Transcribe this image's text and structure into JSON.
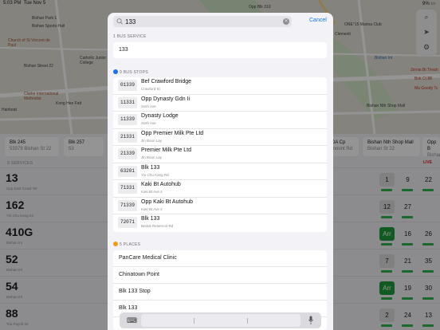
{
  "status_bar": {
    "time": "5:03 PM",
    "date": "Tue Nov 5",
    "right": "9% ▭"
  },
  "map": {
    "labels": [
      {
        "text": "Bishan Park 1",
        "tone": "normal"
      },
      {
        "text": "Bishan Sports Hall",
        "tone": "normal"
      },
      {
        "text": "ONE°15 Marina Club",
        "tone": "normal"
      },
      {
        "text": "Church of St Vincent de Paul",
        "tone": "brown"
      },
      {
        "text": "Bishan Street 22",
        "tone": "normal"
      },
      {
        "text": "Catholic Junior College",
        "tone": "normal"
      },
      {
        "text": "Clementi",
        "tone": "normal"
      },
      {
        "text": "Opp Blk 310",
        "tone": "normal"
      },
      {
        "text": "Clarke International Methodist",
        "tone": "brown"
      },
      {
        "text": "Kong Hee Fatt",
        "tone": "normal"
      },
      {
        "text": "Hairbeat",
        "tone": "normal"
      },
      {
        "text": "Bishan Int",
        "tone": "blue"
      },
      {
        "text": "Zinnia Bt Timah",
        "tone": "pin"
      },
      {
        "text": "Bnk Ct 88",
        "tone": "pin"
      },
      {
        "text": "Ma Goody Tc",
        "tone": "pin"
      },
      {
        "text": "Bishan Nth Shop Mall",
        "tone": "normal"
      }
    ],
    "controls": [
      "⌕",
      "➤",
      "⚙"
    ]
  },
  "background": {
    "stop_tabs": [
      {
        "name": "Blk 245",
        "code": "53379 Bishan St 22"
      },
      {
        "name": "Blk 257",
        "code": "53"
      },
      {
        "name": "DA Cp",
        "code": "mount Rd"
      },
      {
        "name": "Bishan Nth Shop Mall",
        "code": "Bishan St 22"
      },
      {
        "name": "Opp B",
        "code": "Bishan"
      }
    ],
    "services_header": "9 SERVICES",
    "live": "LIVE",
    "services": [
      {
        "number": "13",
        "dest": "Upp East Coast Ter",
        "etas": [
          {
            "v": "1",
            "kind": "box"
          },
          {
            "v": "9",
            "kind": "plain"
          },
          {
            "v": "22",
            "kind": "plain"
          }
        ]
      },
      {
        "number": "162",
        "dest": "Yio Chu Kang Int",
        "etas": [
          {
            "v": "12",
            "kind": "box"
          },
          {
            "v": "27",
            "kind": "plain"
          },
          {
            "v": "",
            "kind": "plain"
          }
        ]
      },
      {
        "number": "410G",
        "dest": "Bishan Int",
        "etas": [
          {
            "v": "Arr",
            "kind": "arr"
          },
          {
            "v": "16",
            "kind": "plain"
          },
          {
            "v": "26",
            "kind": "plain"
          }
        ]
      },
      {
        "number": "52",
        "dest": "Bishan Int",
        "etas": [
          {
            "v": "7",
            "kind": "box"
          },
          {
            "v": "21",
            "kind": "plain"
          },
          {
            "v": "35",
            "kind": "plain"
          }
        ]
      },
      {
        "number": "54",
        "dest": "Bishan Int",
        "etas": [
          {
            "v": "Arr",
            "kind": "arr"
          },
          {
            "v": "19",
            "kind": "plain"
          },
          {
            "v": "30",
            "kind": "plain"
          }
        ]
      },
      {
        "number": "88",
        "dest": "Toa Payoh Int",
        "etas": [
          {
            "v": "2",
            "kind": "box"
          },
          {
            "v": "24",
            "kind": "plain"
          },
          {
            "v": "13",
            "kind": "plain"
          }
        ]
      }
    ]
  },
  "search": {
    "query": "133",
    "cancel_label": "Cancel",
    "service_section": "1 BUS SERVICE",
    "services": [
      "133"
    ],
    "stops_section": "9 BUS STOPS",
    "stops": [
      {
        "code": "01339",
        "name": "Bef Crawford Bridge",
        "road": "Crawford St"
      },
      {
        "code": "11331",
        "name": "Opp Dynasty Gdn Ii",
        "road": "Sixth Ave"
      },
      {
        "code": "11339",
        "name": "Dynasty Lodge",
        "road": "Sixth Ave"
      },
      {
        "code": "21331",
        "name": "Opp Premier Milk Pte Ltd",
        "road": "Jln Boon Lay"
      },
      {
        "code": "21339",
        "name": "Premier Milk Pte Ltd",
        "road": "Jln Boon Lay"
      },
      {
        "code": "63201",
        "name": "Blk 133",
        "road": "Yio Chu Kang Rd"
      },
      {
        "code": "71331",
        "name": "Kaki Bt Autohub",
        "road": "Kaki Bt Ave 2"
      },
      {
        "code": "71339",
        "name": "Opp Kaki Bt Autohub",
        "road": "Kaki Bt Ave 2"
      },
      {
        "code": "72071",
        "name": "Blk 133",
        "road": "Bedok Reservoir Rd"
      }
    ],
    "places_section": "5 PLACES",
    "places": [
      "PanCare Medical Clinic",
      "Chinatown Point",
      "Blk 133 Stop",
      "Blk 133"
    ]
  },
  "keyboard_bar": {
    "keyboard_icon": "⌨"
  }
}
